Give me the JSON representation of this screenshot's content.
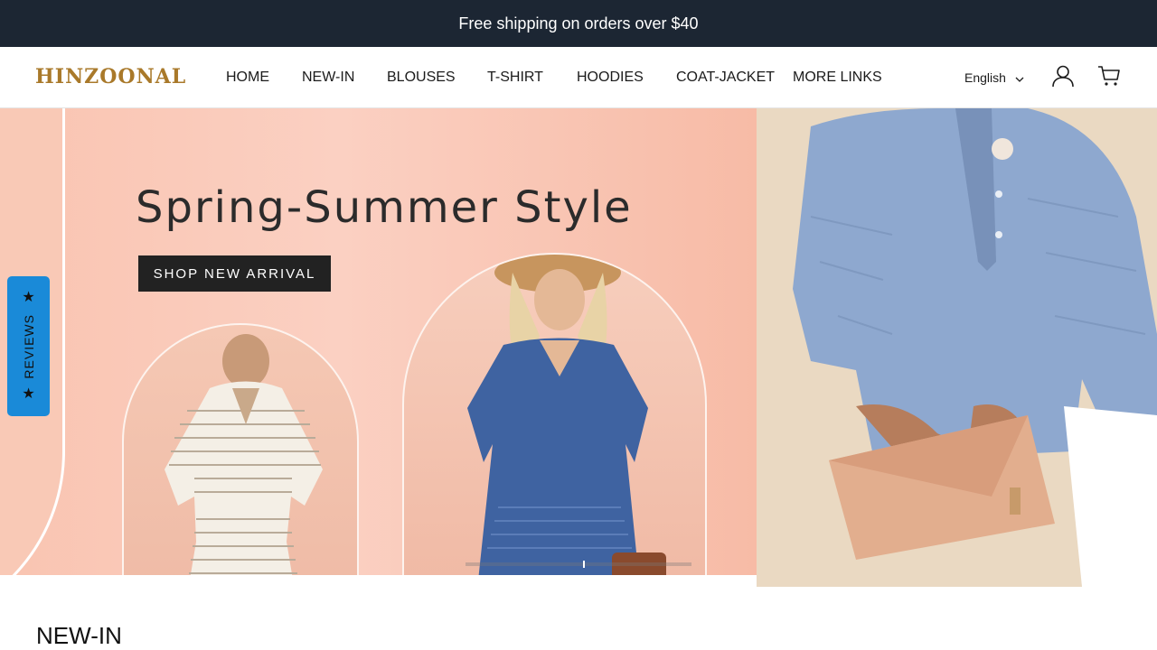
{
  "announcement": "Free shipping on orders over $40",
  "brand": "HINZOONAL",
  "nav": [
    "HOME",
    "NEW-IN",
    "BLOUSES",
    "T-SHIRT",
    "HOODIES",
    "COAT-JACKET",
    "MORE LINKS"
  ],
  "language": "English",
  "icons": {
    "chevron": "chevron-down-icon",
    "account": "user-icon",
    "cart": "cart-icon",
    "star": "star-icon"
  },
  "hero": {
    "title": "Spring-Summer Style",
    "cta": "SHOP NEW ARRIVAL"
  },
  "reviews_tab": "REVIEWS",
  "section": {
    "title": "NEW-IN"
  },
  "colors": {
    "announcement_bg": "#1c2633",
    "brand": "#a9792a",
    "reviews_tab": "#1a8ad8",
    "cta_bg": "#222222"
  }
}
